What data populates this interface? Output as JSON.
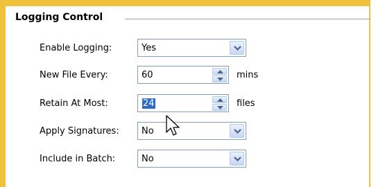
{
  "group": {
    "title": "Logging Control"
  },
  "rows": {
    "enable_logging": {
      "label": "Enable Logging:",
      "value": "Yes"
    },
    "new_file_every": {
      "label": "New File Every:",
      "value": "60",
      "unit": "mins"
    },
    "retain_at_most": {
      "label": "Retain At Most:",
      "value": "24",
      "unit": "files"
    },
    "apply_signatures": {
      "label": "Apply Signatures:",
      "value": "No"
    },
    "include_in_batch": {
      "label": "Include in Batch:",
      "value": "No"
    }
  },
  "icons": {
    "dropdown": "chevron-down-icon",
    "spin_up": "arrow-up-icon",
    "spin_down": "arrow-down-icon",
    "cursor": "mouse-pointer-icon"
  },
  "colors": {
    "accent_border": "#f0c23b",
    "selection": "#316ac5",
    "field_border": "#7f9db9"
  }
}
